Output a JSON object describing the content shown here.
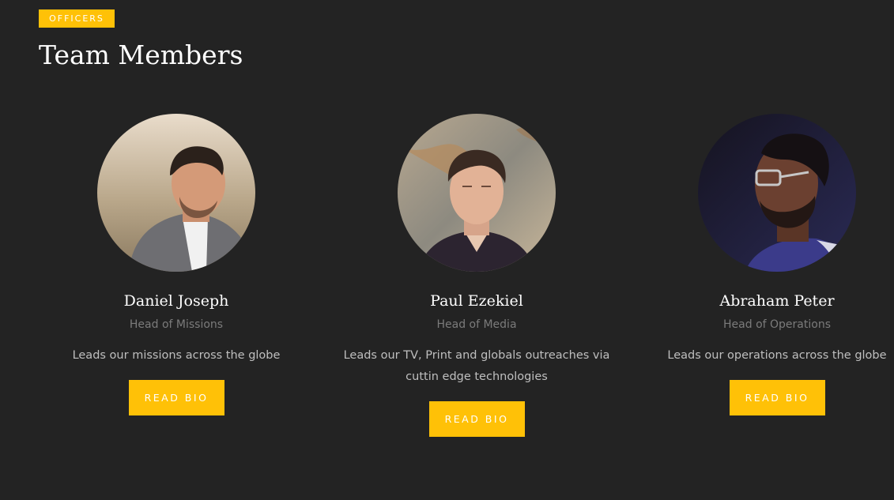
{
  "section": {
    "badge": "OFFICERS",
    "title": "Team Members"
  },
  "members": [
    {
      "name": "Daniel Joseph",
      "role": "Head of Missions",
      "description": "Leads our missions across the globe",
      "button_label": "READ BIO"
    },
    {
      "name": "Paul Ezekiel",
      "role": "Head of Media",
      "description": "Leads our TV, Print and globals outreaches via cuttin edge technologies",
      "button_label": "READ BIO"
    },
    {
      "name": "Abraham Peter",
      "role": "Head of Operations",
      "description": "Leads our operations across the globe",
      "button_label": "READ BIO"
    }
  ],
  "colors": {
    "background": "#232323",
    "accent": "#ffc107",
    "role_text": "#7b7b7b",
    "desc_text": "#bfbfbf"
  }
}
